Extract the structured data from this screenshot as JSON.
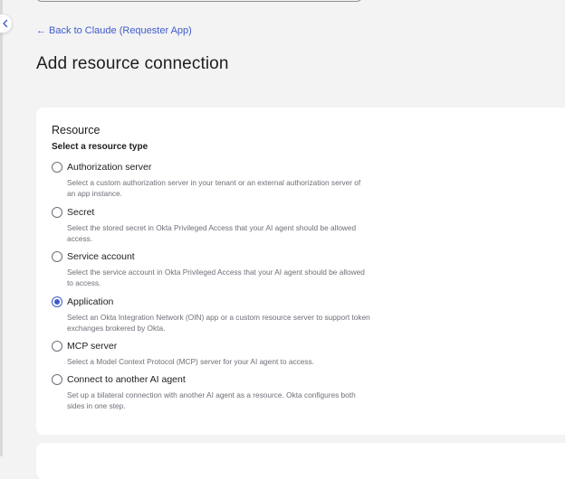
{
  "nav": {
    "back_link": "← Back to Claude (Requester App)"
  },
  "page": {
    "title": "Add resource connection"
  },
  "resource": {
    "title": "Resource",
    "subtitle": "Select a resource type",
    "options": [
      {
        "label": "Authorization server",
        "description": "Select a custom authorization server in your tenant or an external authorization server of an app instance.",
        "checked": false
      },
      {
        "label": "Secret",
        "description": "Select the stored secret in Okta Privileged Access that your AI agent should be allowed access.",
        "checked": false
      },
      {
        "label": "Service account",
        "description": "Select the service account in Okta Privileged Access that your AI agent should be allowed to access.",
        "checked": false
      },
      {
        "label": "Application",
        "description": "Select an Okta Integration Network (OIN) app or a custom resource server to support token exchanges brokered by Okta.",
        "checked": true
      },
      {
        "label": "MCP server",
        "description": "Select a Model Context Protocol (MCP) server for your AI agent to access.",
        "checked": false
      },
      {
        "label": "Connect to another AI agent",
        "description": "Set up a bilateral connection with another AI agent as a resource. Okta configures both sides in one step.",
        "checked": false
      }
    ]
  },
  "colors": {
    "accent": "#3e5ccb",
    "background": "#f3f3f3",
    "card": "#ffffff"
  },
  "icons": {
    "collapse": "chevron-left-icon"
  }
}
